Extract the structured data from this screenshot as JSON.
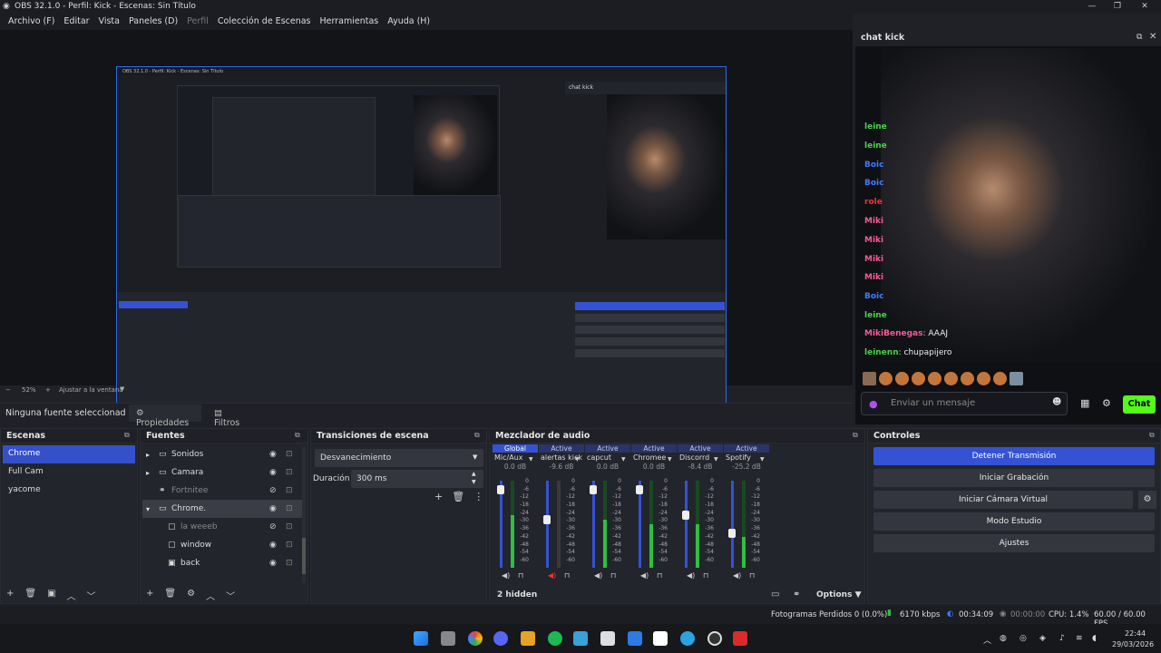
{
  "window": {
    "title": "OBS 32.1.0 - Perfil: Kick - Escenas: Sin Título"
  },
  "menu": {
    "items": [
      "Archivo (F)",
      "Editar",
      "Vista",
      "Paneles (D)",
      "Perfil",
      "Colección de Escenas",
      "Herramientas",
      "Ayuda (H)"
    ],
    "disabled": [
      "Perfil"
    ]
  },
  "preview": {
    "zoom": "52%",
    "fit_label": "Ajustar a la ventana"
  },
  "status_row": {
    "no_source": "Ninguna fuente seleccionad",
    "properties": "Propiedades",
    "filters": "Filtros"
  },
  "chat": {
    "title": "chat kick",
    "names": [
      "leine",
      "leine",
      "Boic",
      "Boic",
      "role",
      "Miki",
      "Miki",
      "Miki",
      "Miki",
      "Boic",
      "leine"
    ],
    "name_colors": [
      "#4ad14a",
      "#4ad14a",
      "#3f7cff",
      "#3f7cff",
      "#e33",
      "#f45b9c",
      "#f45b9c",
      "#f45b9c",
      "#f45b9c",
      "#3f7cff",
      "#4ad14a"
    ],
    "messages": [
      {
        "user": "MikiBenegas",
        "text": "AAAJ",
        "color": "#f45b9c"
      },
      {
        "user": "leinenn",
        "text": "chupapijero",
        "color": "#4ad14a"
      }
    ],
    "placeholder": "Enviar un mensaje",
    "send": "Chat"
  },
  "scenes": {
    "title": "Escenas",
    "items": [
      "Chrome",
      "Full Cam",
      "yacome"
    ],
    "selected": 0
  },
  "sources": {
    "title": "Fuentes",
    "items": [
      {
        "label": "Sonidos",
        "indent": 0,
        "icon": "folder-icon",
        "hidden": false
      },
      {
        "label": "Camara",
        "indent": 0,
        "icon": "folder-icon",
        "hidden": false
      },
      {
        "label": "Fortnitee",
        "indent": 0,
        "icon": "link-icon",
        "hidden": true
      },
      {
        "label": "Chrome.",
        "indent": 0,
        "icon": "folder-icon",
        "hidden": false
      },
      {
        "label": "la weeeb",
        "indent": 1,
        "icon": "window-icon",
        "hidden": true
      },
      {
        "label": "window",
        "indent": 1,
        "icon": "window-icon",
        "hidden": false
      },
      {
        "label": "back",
        "indent": 1,
        "icon": "image-icon",
        "hidden": false
      }
    ]
  },
  "transitions": {
    "title": "Transiciones de escena",
    "type": "Desvanecimiento",
    "duration_label": "Duración",
    "duration": "300 ms"
  },
  "mixer": {
    "title": "Mezclador de audio",
    "channels": [
      {
        "state": "Global",
        "name": "Mic/Aux",
        "db": "0.0 dB",
        "level": 0.9,
        "meter": 0.6,
        "muted": false
      },
      {
        "state": "Active",
        "name": "alertas kick",
        "db": "-9.6 dB",
        "level": 0.55,
        "meter": 0.0,
        "muted": true
      },
      {
        "state": "Active",
        "name": "capcut",
        "db": "0.0 dB",
        "level": 0.9,
        "meter": 0.55,
        "muted": false
      },
      {
        "state": "Active",
        "name": "Chromee",
        "db": "0.0 dB",
        "level": 0.9,
        "meter": 0.5,
        "muted": false
      },
      {
        "state": "Active",
        "name": "Discorrd",
        "db": "-8.4 dB",
        "level": 0.6,
        "meter": 0.5,
        "muted": false
      },
      {
        "state": "Active",
        "name": "Spotify",
        "db": "-25.2 dB",
        "level": 0.4,
        "meter": 0.35,
        "muted": false
      }
    ],
    "scale": [
      "0",
      "-6",
      "-12",
      "-18",
      "-24",
      "-30",
      "-36",
      "-42",
      "-48",
      "-54",
      "-60"
    ],
    "hidden": "2 hidden",
    "options": "Options"
  },
  "controls": {
    "title": "Controles",
    "buttons": [
      "Detener Transmisión",
      "Iniciar Grabación",
      "Iniciar Cámara Virtual",
      "Modo Estudio",
      "Ajustes"
    ]
  },
  "status": {
    "frames": "Fotogramas Perdidos 0 (0.0%)",
    "kbps": "6170 kbps",
    "stream_time": "00:34:09",
    "rec_time": "00:00:00",
    "cpu": "CPU: 1.4%",
    "fps": "60.00 / 60.00 FPS"
  },
  "taskbar": {
    "time": "22:44",
    "date": "29/03/2026"
  },
  "colors": {
    "accent": "#3552d4",
    "chat_send": "#53fc18",
    "meter": "#2fbf42"
  }
}
